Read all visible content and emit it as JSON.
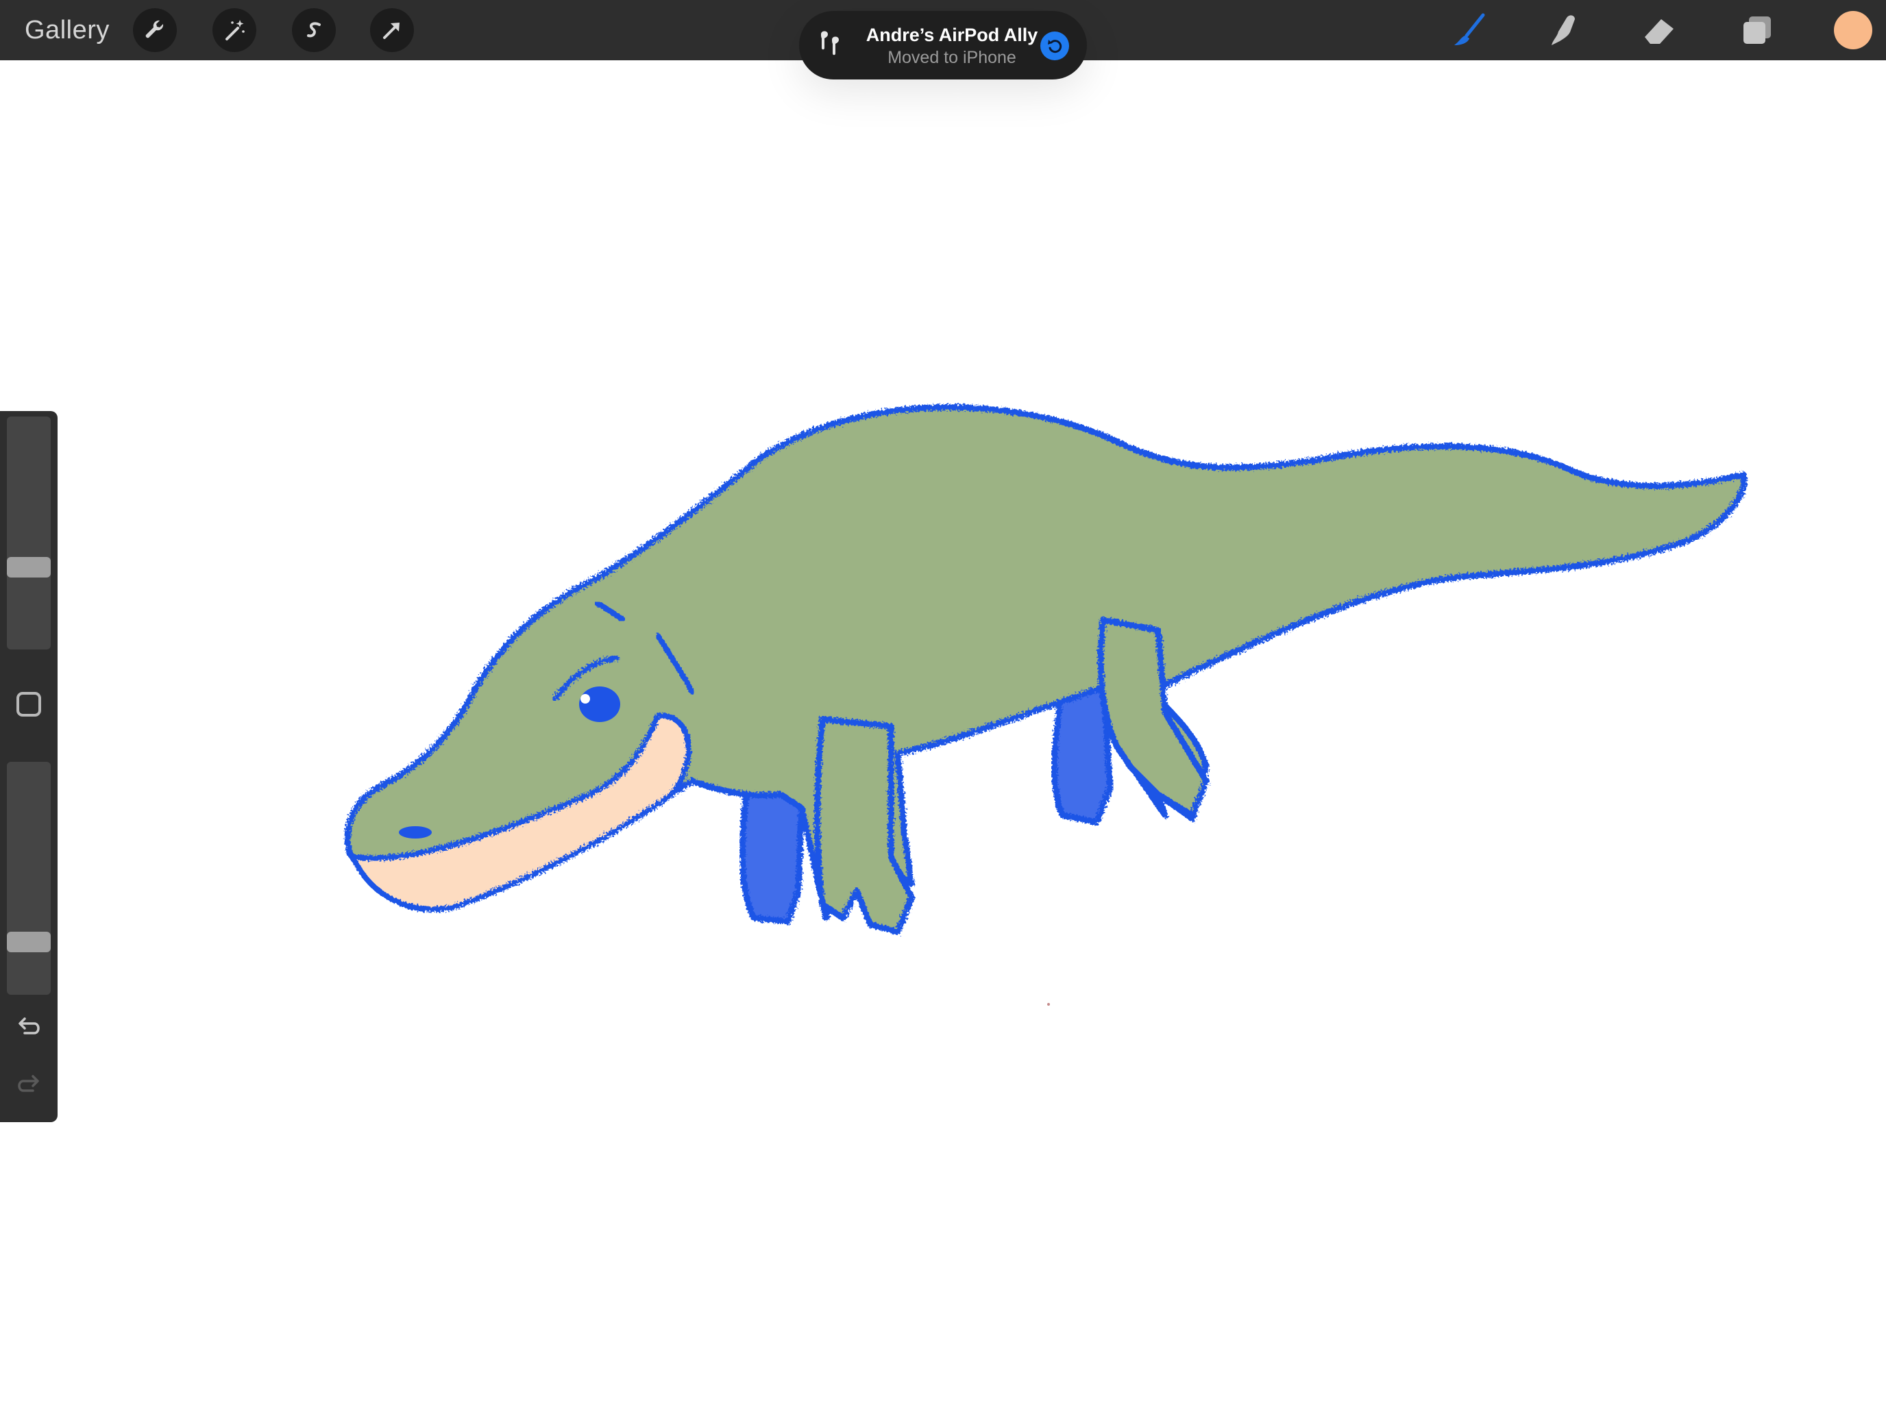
{
  "toolbar": {
    "gallery_label": "Gallery",
    "left_tools": [
      "wrench-icon",
      "magic-wand-icon",
      "selection-icon",
      "transform-arrow-icon"
    ],
    "right_tools": [
      "brush-icon",
      "smudge-icon",
      "eraser-icon",
      "layers-icon"
    ],
    "active_tool": "brush",
    "active_tool_color": "#1f6fe0",
    "current_color": "#f9b989"
  },
  "notification": {
    "title": "Andre’s AirPod Ally",
    "subtitle": "Moved to iPhone",
    "icon": "airpods-icon",
    "action_icon": "undo-arrow-icon"
  },
  "sidebar": {
    "brush_size_level": 0.34,
    "opacity_level": 0.2,
    "controls": [
      "brush-size-slider",
      "modify-button",
      "opacity-slider",
      "undo-icon",
      "redo-icon"
    ],
    "redo_enabled": false
  },
  "canvas": {
    "background": "#ffffff",
    "subject": "crocodile",
    "colors": {
      "body": "#9cb384",
      "outline": "#1e54e6",
      "belly": "#fddcc1"
    }
  }
}
